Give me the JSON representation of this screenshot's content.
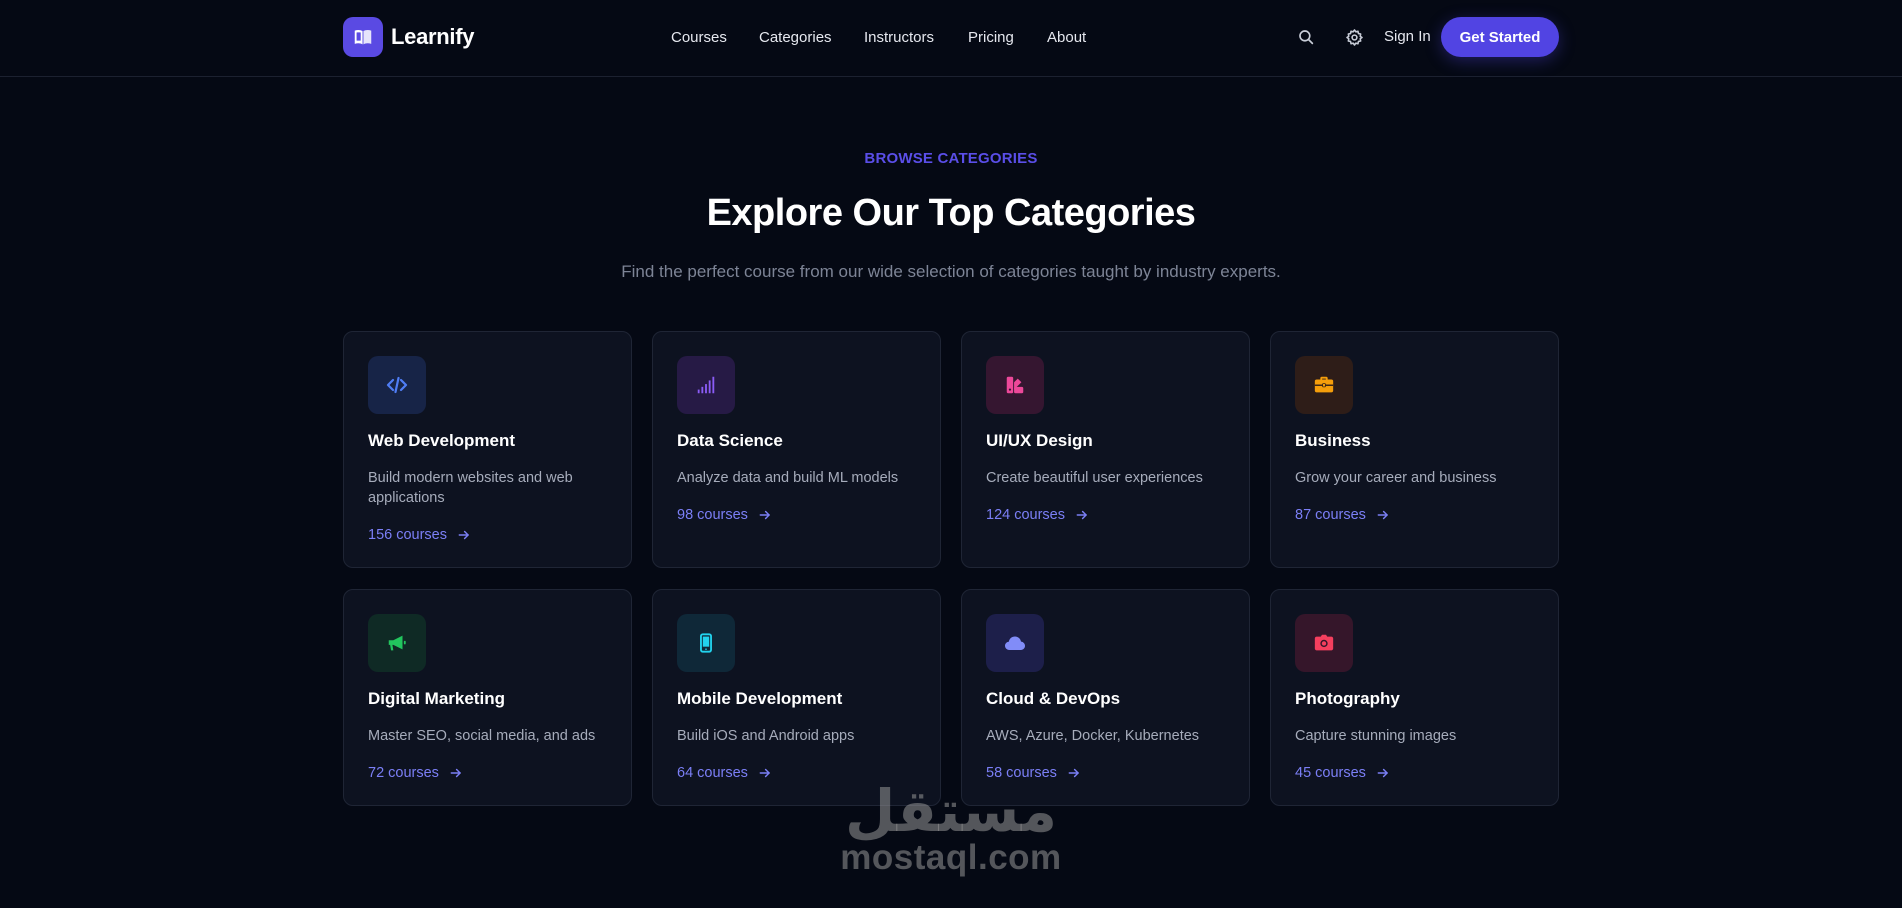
{
  "header": {
    "brand": "Learnify",
    "nav": [
      "Courses",
      "Categories",
      "Instructors",
      "Pricing",
      "About"
    ],
    "sign_in": "Sign In",
    "cta": "Get Started"
  },
  "hero": {
    "eyebrow": "BROWSE CATEGORIES",
    "title": "Explore Our Top Categories",
    "subtitle": "Find the perfect course from our wide selection of categories taught by industry experts."
  },
  "categories": [
    {
      "title": "Web Development",
      "desc": "Build modern websites and web applications",
      "count": "156 courses",
      "icon": "code-icon",
      "color": "#4f7df5",
      "bg": "#172447"
    },
    {
      "title": "Data Science",
      "desc": "Analyze data and build ML models",
      "count": "98 courses",
      "icon": "chart-bars-icon",
      "color": "#8b5cf6",
      "bg": "#261a45"
    },
    {
      "title": "UI/UX Design",
      "desc": "Create beautiful user experiences",
      "count": "124 courses",
      "icon": "palette-icon",
      "color": "#ec4899",
      "bg": "#351630"
    },
    {
      "title": "Business",
      "desc": "Grow your career and business",
      "count": "87 courses",
      "icon": "briefcase-icon",
      "color": "#f59e0b",
      "bg": "#2e1d18"
    },
    {
      "title": "Digital Marketing",
      "desc": "Master SEO, social media, and ads",
      "count": "72 courses",
      "icon": "megaphone-icon",
      "color": "#22c55e",
      "bg": "#0f2a25"
    },
    {
      "title": "Mobile Development",
      "desc": "Build iOS and Android apps",
      "count": "64 courses",
      "icon": "smartphone-icon",
      "color": "#22d3ee",
      "bg": "#0f2838"
    },
    {
      "title": "Cloud & DevOps",
      "desc": "AWS, Azure, Docker, Kubernetes",
      "count": "58 courses",
      "icon": "cloud-icon",
      "color": "#818cf8",
      "bg": "#1d1f4a"
    },
    {
      "title": "Photography",
      "desc": "Capture stunning images",
      "count": "45 courses",
      "icon": "camera-icon",
      "color": "#f43f5e",
      "bg": "#35162a"
    }
  ],
  "watermark": {
    "arabic": "مستقل",
    "latin": "mostaql.com"
  }
}
